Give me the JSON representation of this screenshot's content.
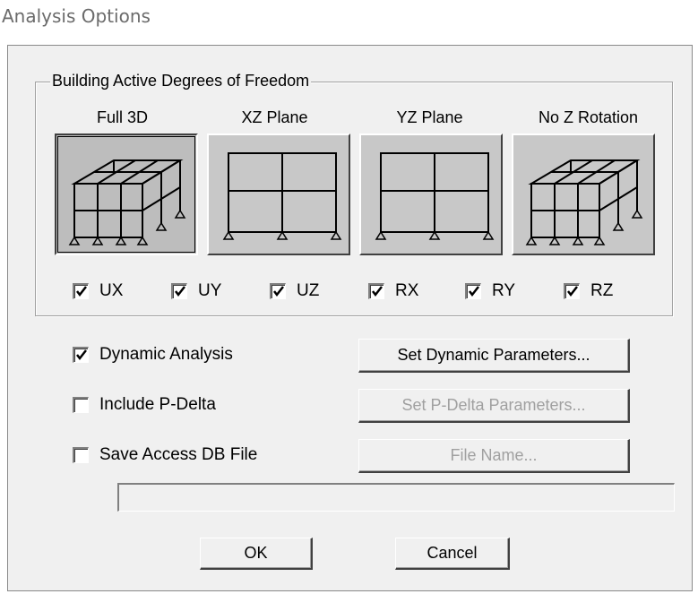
{
  "window": {
    "title": "Analysis Options"
  },
  "dof_group": {
    "legend": "Building Active Degrees of Freedom",
    "modes": [
      {
        "label": "Full 3D",
        "icon": "frame-3d-icon",
        "selected": true
      },
      {
        "label": "XZ Plane",
        "icon": "frame-2d-icon",
        "selected": false
      },
      {
        "label": "YZ Plane",
        "icon": "frame-2d-icon",
        "selected": false
      },
      {
        "label": "No Z Rotation",
        "icon": "frame-3d-icon",
        "selected": false
      }
    ],
    "checkboxes": [
      {
        "label": "UX",
        "checked": true
      },
      {
        "label": "UY",
        "checked": true
      },
      {
        "label": "UZ",
        "checked": true
      },
      {
        "label": "RX",
        "checked": true
      },
      {
        "label": "RY",
        "checked": true
      },
      {
        "label": "RZ",
        "checked": true
      }
    ]
  },
  "options": {
    "dynamic_analysis": {
      "label": "Dynamic Analysis",
      "checked": true,
      "button": "Set Dynamic Parameters...",
      "button_enabled": true
    },
    "p_delta": {
      "label": "Include P-Delta",
      "checked": false,
      "button": "Set P-Delta Parameters...",
      "button_enabled": false
    },
    "access_db": {
      "label": "Save Access DB File",
      "checked": false,
      "button": "File Name...",
      "button_enabled": false
    },
    "file_path": {
      "value": ""
    }
  },
  "buttons": {
    "ok": "OK",
    "cancel": "Cancel"
  }
}
